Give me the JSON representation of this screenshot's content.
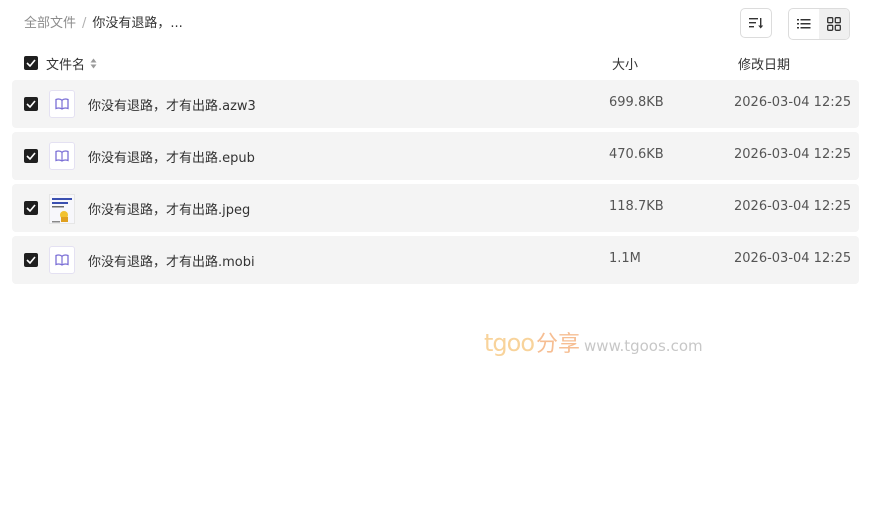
{
  "breadcrumb": {
    "root": "全部文件",
    "separator": "/",
    "current": "你没有退路，..."
  },
  "toolbar": {
    "sort_icon": "sort-icon",
    "list_view_icon": "list-view-icon",
    "grid_view_icon": "grid-view-icon",
    "active_view": "grid"
  },
  "header": {
    "name": "文件名",
    "size": "大小",
    "date": "修改日期",
    "all_checked": true
  },
  "files": [
    {
      "name": "你没有退路，才有出路.azw3",
      "size": "699.8KB",
      "date": "2026-03-04 12:25",
      "icon": "ebook-icon",
      "checked": true
    },
    {
      "name": "你没有退路，才有出路.epub",
      "size": "470.6KB",
      "date": "2026-03-04 12:25",
      "icon": "ebook-icon",
      "checked": true
    },
    {
      "name": "你没有退路，才有出路.jpeg",
      "size": "118.7KB",
      "date": "2026-03-04 12:25",
      "icon": "image-thumbnail",
      "checked": true
    },
    {
      "name": "你没有退路，才有出路.mobi",
      "size": "1.1M",
      "date": "2026-03-04 12:25",
      "icon": "ebook-icon",
      "checked": true
    }
  ],
  "watermark": {
    "brand": "tgoo",
    "brand_suffix": "分享",
    "url": "www.tgoos.com"
  },
  "colors": {
    "row_bg": "#f4f4f4",
    "checkbox": "#1f1f1f",
    "ebook_icon": "#7b6fd6"
  }
}
